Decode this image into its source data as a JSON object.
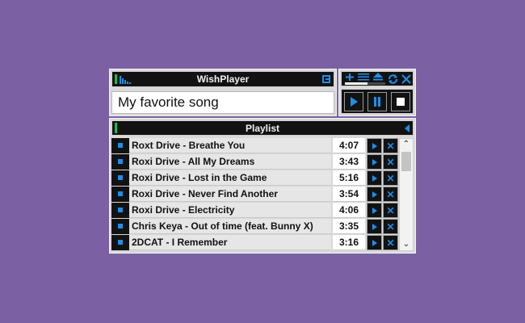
{
  "player": {
    "title": "WishPlayer",
    "current_song": "My favorite song"
  },
  "controls": {
    "volume_level": 0.55,
    "icons": [
      "plus-icon",
      "list-icon",
      "eject-icon",
      "repeat-icon",
      "close-icon",
      "play-icon",
      "pause-icon",
      "stop-icon"
    ]
  },
  "playlist": {
    "title": "Playlist",
    "tracks": [
      {
        "name": "Roxt Drive - Breathe You",
        "duration": "4:07"
      },
      {
        "name": "Roxi Drive - All My Dreams",
        "duration": "3:43"
      },
      {
        "name": "Roxi Drive - Lost in the Game",
        "duration": "5:16"
      },
      {
        "name": "Roxi Drive - Never Find Another",
        "duration": "3:54"
      },
      {
        "name": "Roxi Drive -  Electricity",
        "duration": "4:06"
      },
      {
        "name": "Chris Keya - Out of time (feat. Bunny X)",
        "duration": "3:35"
      },
      {
        "name": "2DCAT - I Remember",
        "duration": "3:16"
      }
    ]
  },
  "colors": {
    "background": "#7b61a3",
    "accent": "#1e8ee9",
    "green": "#1bbf3a",
    "panel": "#121212"
  }
}
